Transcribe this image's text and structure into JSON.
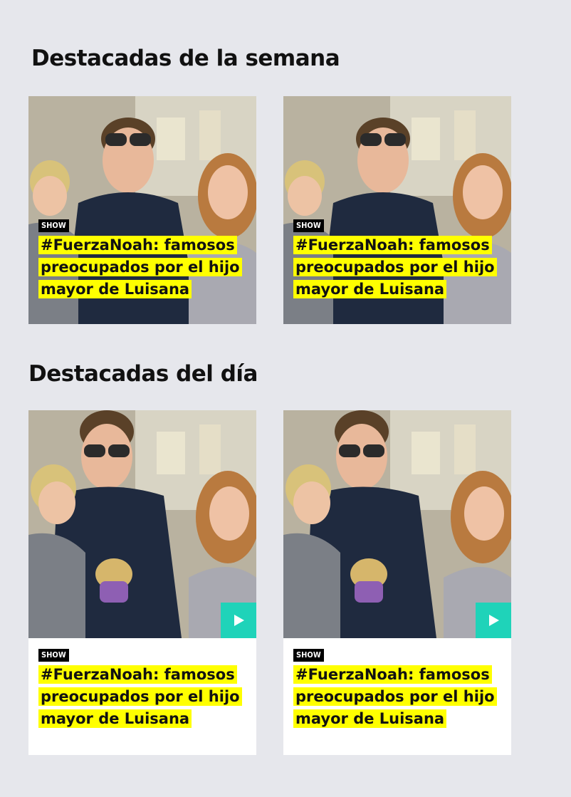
{
  "sections": [
    {
      "title": "Destacadas de la semana",
      "cards": [
        {
          "badge": "SHOW",
          "headline": "#FuerzaNoah: famosos preocupados por el hijo mayor de Luisana"
        },
        {
          "badge": "SHOW",
          "headline": "#FuerzaNoah: famosos preocupados por el hijo mayor de Luisana"
        }
      ]
    },
    {
      "title": "Destacadas del día",
      "cards": [
        {
          "badge": "SHOW",
          "headline": "#FuerzaNoah: famosos preocupados por el hijo mayor de Luisana",
          "media_icon": "play-icon"
        },
        {
          "badge": "SHOW",
          "headline": "#FuerzaNoah: famosos preocupados por el hijo mayor de Luisana",
          "media_icon": "play-icon"
        }
      ]
    }
  ],
  "colors": {
    "page_background": "#e6e7ec",
    "headline_highlight": "#ffff00",
    "badge_background": "#000000",
    "play_button": "#1fd3b9"
  }
}
